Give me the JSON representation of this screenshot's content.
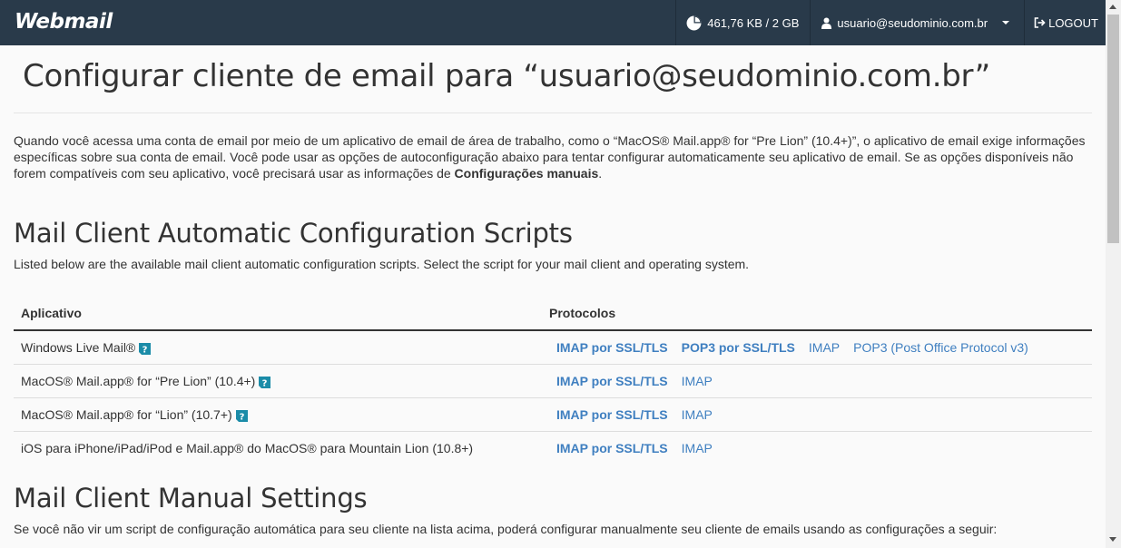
{
  "header": {
    "logo": "Webmail",
    "quota": "461,76 KB / 2 GB",
    "user": "usuario@seudominio.com.br",
    "logout": "LOGOUT"
  },
  "page": {
    "title": "Configurar cliente de email para “usuario@seudominio.com.br”",
    "intro_part1": "Quando você acessa uma conta de email por meio de um aplicativo de email de área de trabalho, como o “MacOS® Mail.app® for “Pre Lion” (10.4+)”, o aplicativo de email exige informações específicas sobre sua conta de email. Você pode usar as opções de autoconfiguração abaixo para tentar configurar automaticamente seu aplicativo de email. Se as opções disponíveis não forem compatíveis com seu aplicativo, você precisará usar as informações de ",
    "intro_bold": "Configurações manuais",
    "intro_end": "."
  },
  "auto": {
    "heading": "Mail Client Automatic Configuration Scripts",
    "description": "Listed below are the available mail client automatic configuration scripts. Select the script for your mail client and operating system.",
    "columns": {
      "app": "Aplicativo",
      "protocols": "Protocolos"
    },
    "rows": [
      {
        "app": "Windows Live Mail®",
        "help": true,
        "protocols": [
          {
            "label": "IMAP por SSL/TLS",
            "bold": true
          },
          {
            "label": "POP3 por SSL/TLS",
            "bold": true
          },
          {
            "label": "IMAP",
            "bold": false
          },
          {
            "label": "POP3 (Post Office Protocol v3)",
            "bold": false
          }
        ]
      },
      {
        "app": "MacOS® Mail.app® for “Pre Lion” (10.4+)",
        "help": true,
        "protocols": [
          {
            "label": "IMAP por SSL/TLS",
            "bold": true
          },
          {
            "label": "IMAP",
            "bold": false
          }
        ]
      },
      {
        "app": "MacOS® Mail.app® for “Lion” (10.7+)",
        "help": true,
        "protocols": [
          {
            "label": "IMAP por SSL/TLS",
            "bold": true
          },
          {
            "label": "IMAP",
            "bold": false
          }
        ]
      },
      {
        "app": "iOS para iPhone/iPad/iPod e Mail.app® do MacOS® para Mountain Lion (10.8+)",
        "help": false,
        "protocols": [
          {
            "label": "IMAP por SSL/TLS",
            "bold": true
          },
          {
            "label": "IMAP",
            "bold": false
          }
        ]
      }
    ]
  },
  "manual": {
    "heading": "Mail Client Manual Settings",
    "description": "Se você não vir um script de configuração automática para seu cliente na lista acima, poderá configurar manualmente seu cliente de emails usando as configurações a seguir:"
  },
  "colors": {
    "header_bg": "#293a4a",
    "link": "#3f7fc0",
    "help_icon": "#1b8ca8"
  }
}
